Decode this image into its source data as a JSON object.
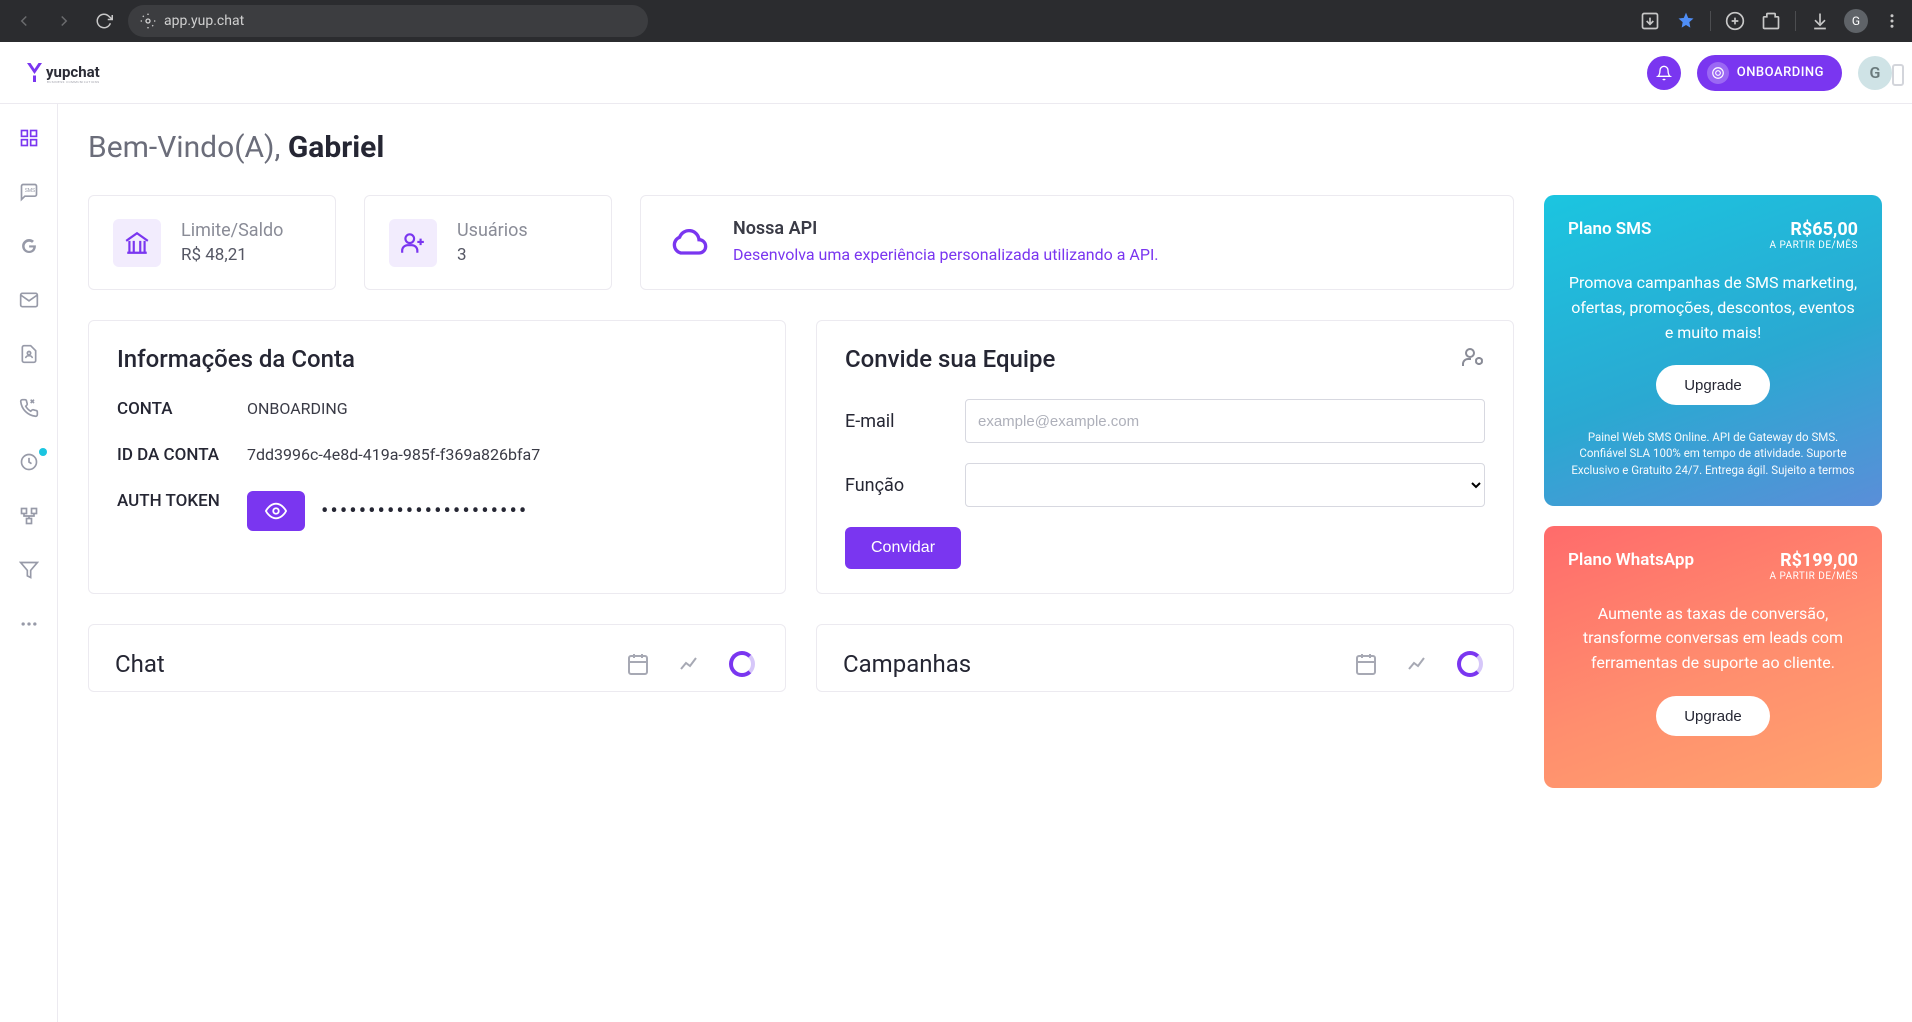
{
  "browser": {
    "url": "app.yup.chat",
    "profile_initial": "G"
  },
  "header": {
    "onboarding_label": "ONBOARDING",
    "avatar_initial": "G"
  },
  "welcome": {
    "prefix": "Bem-Vindo(A), ",
    "name": "Gabriel"
  },
  "stats": {
    "balance": {
      "label": "Limite/Saldo",
      "value": "R$ 48,21"
    },
    "users": {
      "label": "Usuários",
      "value": "3"
    },
    "api": {
      "title": "Nossa API",
      "desc": "Desenvolva uma experiência personalizada utilizando a API."
    }
  },
  "account_info": {
    "title": "Informações da Conta",
    "rows": {
      "conta_label": "CONTA",
      "conta_value": "ONBOARDING",
      "id_label": "ID DA CONTA",
      "id_value": "7dd3996c-4e8d-419a-985f-f369a826bfa7",
      "token_label": "AUTH TOKEN",
      "token_mask": "••••••••••••••••••••••"
    }
  },
  "invite": {
    "title": "Convide sua Equipe",
    "email_label": "E-mail",
    "email_placeholder": "example@example.com",
    "role_label": "Função",
    "button": "Convidar"
  },
  "chart_sections": {
    "chat": "Chat",
    "campaigns": "Campanhas"
  },
  "plans": {
    "sms": {
      "name": "Plano SMS",
      "price": "R$65,00",
      "period": "A PARTIR DE/MÊS",
      "desc": "Promova campanhas de SMS marketing, ofertas, promoções, descontos, eventos e muito mais!",
      "upgrade": "Upgrade",
      "fine": "Painel Web SMS Online. API de Gateway do SMS. Confiável SLA 100% em tempo de atividade. Suporte Exclusivo e Gratuito 24/7. Entrega ágil. Sujeito a termos"
    },
    "whatsapp": {
      "name": "Plano WhatsApp",
      "price": "R$199,00",
      "period": "A PARTIR DE/MÊS",
      "desc": "Aumente as taxas de conversão, transforme conversas em leads com ferramentas de suporte ao cliente.",
      "upgrade": "Upgrade"
    }
  }
}
